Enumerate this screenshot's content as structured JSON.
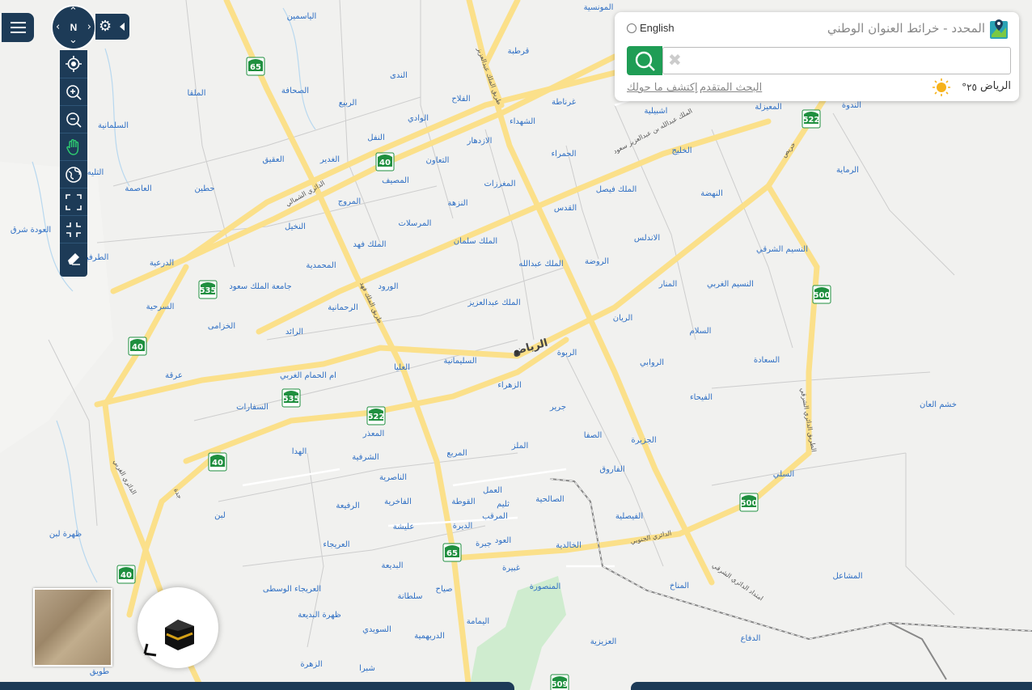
{
  "header": {
    "title": "المحدد - خرائط العنوان الوطني",
    "language": "English"
  },
  "search": {
    "placeholder": "",
    "explore_link": "إكتشف ما حولك",
    "advanced_link": "البحث المتقدم"
  },
  "weather": {
    "city": "الرياض",
    "temperature": "٢٥°",
    "icon": "sun-icon"
  },
  "compass": {
    "label": "N"
  },
  "toolbar": {
    "tools": [
      "locate-icon",
      "zoom-in-icon",
      "zoom-out-icon",
      "pan-hand-icon",
      "globe-icon",
      "fullscreen-icon",
      "exit-fullscreen-icon",
      "eraser-icon"
    ]
  },
  "map": {
    "city_label": "الرياض",
    "districts": [
      "الياسمين",
      "المونسية",
      "قرطبة",
      "الندى",
      "الربيع",
      "الصحافة",
      "الملقا",
      "السلمانية",
      "الفلاح",
      "الوادي",
      "النفل",
      "الازدهار",
      "الشهداء",
      "غرناطة",
      "اشبيلية",
      "المعيزلة",
      "الندوة",
      "العقيق",
      "الغدير",
      "التعاون",
      "المصيف",
      "الحمراء",
      "الخليج",
      "الرماية",
      "حطين",
      "العاصمة",
      "التليه",
      "المروج",
      "النزهة",
      "المغرزات",
      "الملك فيصل",
      "النهضة",
      "النخيل",
      "المرسلات",
      "القدس",
      "الملك سلمان",
      "الاندلس",
      "النسيم الشرقي",
      "الدرعية",
      "الملك فهد",
      "المحمدية",
      "الملك عبدالله",
      "الروضة",
      "جامعة الملك سعود",
      "الورود",
      "النسيم الغربي",
      "المنار",
      "السرحية",
      "الرحمانية",
      "الملك عبدالعزيز",
      "الخزامى",
      "الرائد",
      "الريان",
      "السلام",
      "عرقة",
      "ام الحمام الغربي",
      "العليا",
      "الربوة",
      "الروابي",
      "السعادة",
      "السليمانية",
      "الزهراء",
      "الفيحاء",
      "السفارات",
      "جرير",
      "خشم العان",
      "المعذر",
      "الهدا",
      "الشرفية",
      "المربع",
      "الصفا",
      "الجزيرة",
      "لبن",
      "الملز",
      "الناصرية",
      "الفاروق",
      "السلي",
      "ظهرة لبن",
      "العمل",
      "الفاخرية",
      "الصالحية",
      "الرفيعة",
      "ثليم",
      "القوطة",
      "المرقب",
      "الديرة",
      "الفيصلية",
      "عليشة",
      "العريجاء",
      "جبرة",
      "العود",
      "الخالدية",
      "البديعة",
      "غبيرة",
      "المشاعل",
      "العريجاء الوسطى",
      "سلطانة",
      "صياح",
      "المنصورة",
      "المناخ",
      "ظهرة البديعة",
      "اليمامة",
      "السويدي",
      "الدريهمية",
      "العزيزية",
      "الدفاع",
      "الزهرة",
      "شبرا",
      "طويق",
      "العودة شرق",
      "الطرفية"
    ],
    "road_shields": [
      "65",
      "522",
      "40",
      "500",
      "535",
      "40",
      "535",
      "522",
      "40",
      "500",
      "65",
      "40",
      "509"
    ],
    "road_names": [
      "الدائري الشمالي",
      "طريق الملك عبدالعزيز",
      "الملك عبدالله بن عبدالعزيز",
      "الدائري الشرقي",
      "الدائري الجنوبي",
      "خريص",
      "طريق الملك فهد",
      "الدائري الغربي",
      "الدائري الثاني",
      "جدة"
    ]
  },
  "bottom_bar": {
    "right_text": ""
  }
}
